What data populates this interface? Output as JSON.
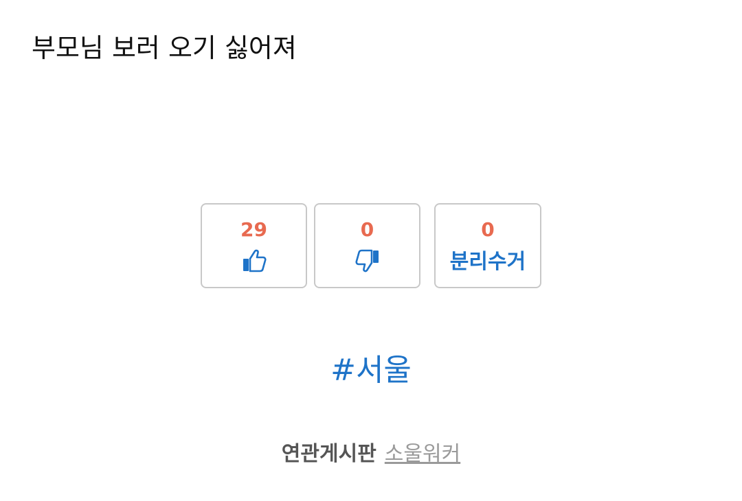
{
  "post": {
    "title": "부모님 보러 오기 싫어져"
  },
  "votes": {
    "like": {
      "count": "29",
      "icon": "thumbs-up-icon"
    },
    "dislike": {
      "count": "0",
      "icon": "thumbs-down-icon"
    },
    "recycle": {
      "count": "0",
      "label": "분리수거"
    }
  },
  "tag": {
    "text": "#서울"
  },
  "related": {
    "label": "연관게시판",
    "link": "소울워커"
  },
  "colors": {
    "count": "#e86a50",
    "accent": "#1e73c8",
    "border": "#c8c8c8",
    "related_label": "#555555",
    "related_link": "#9a9a9a"
  }
}
